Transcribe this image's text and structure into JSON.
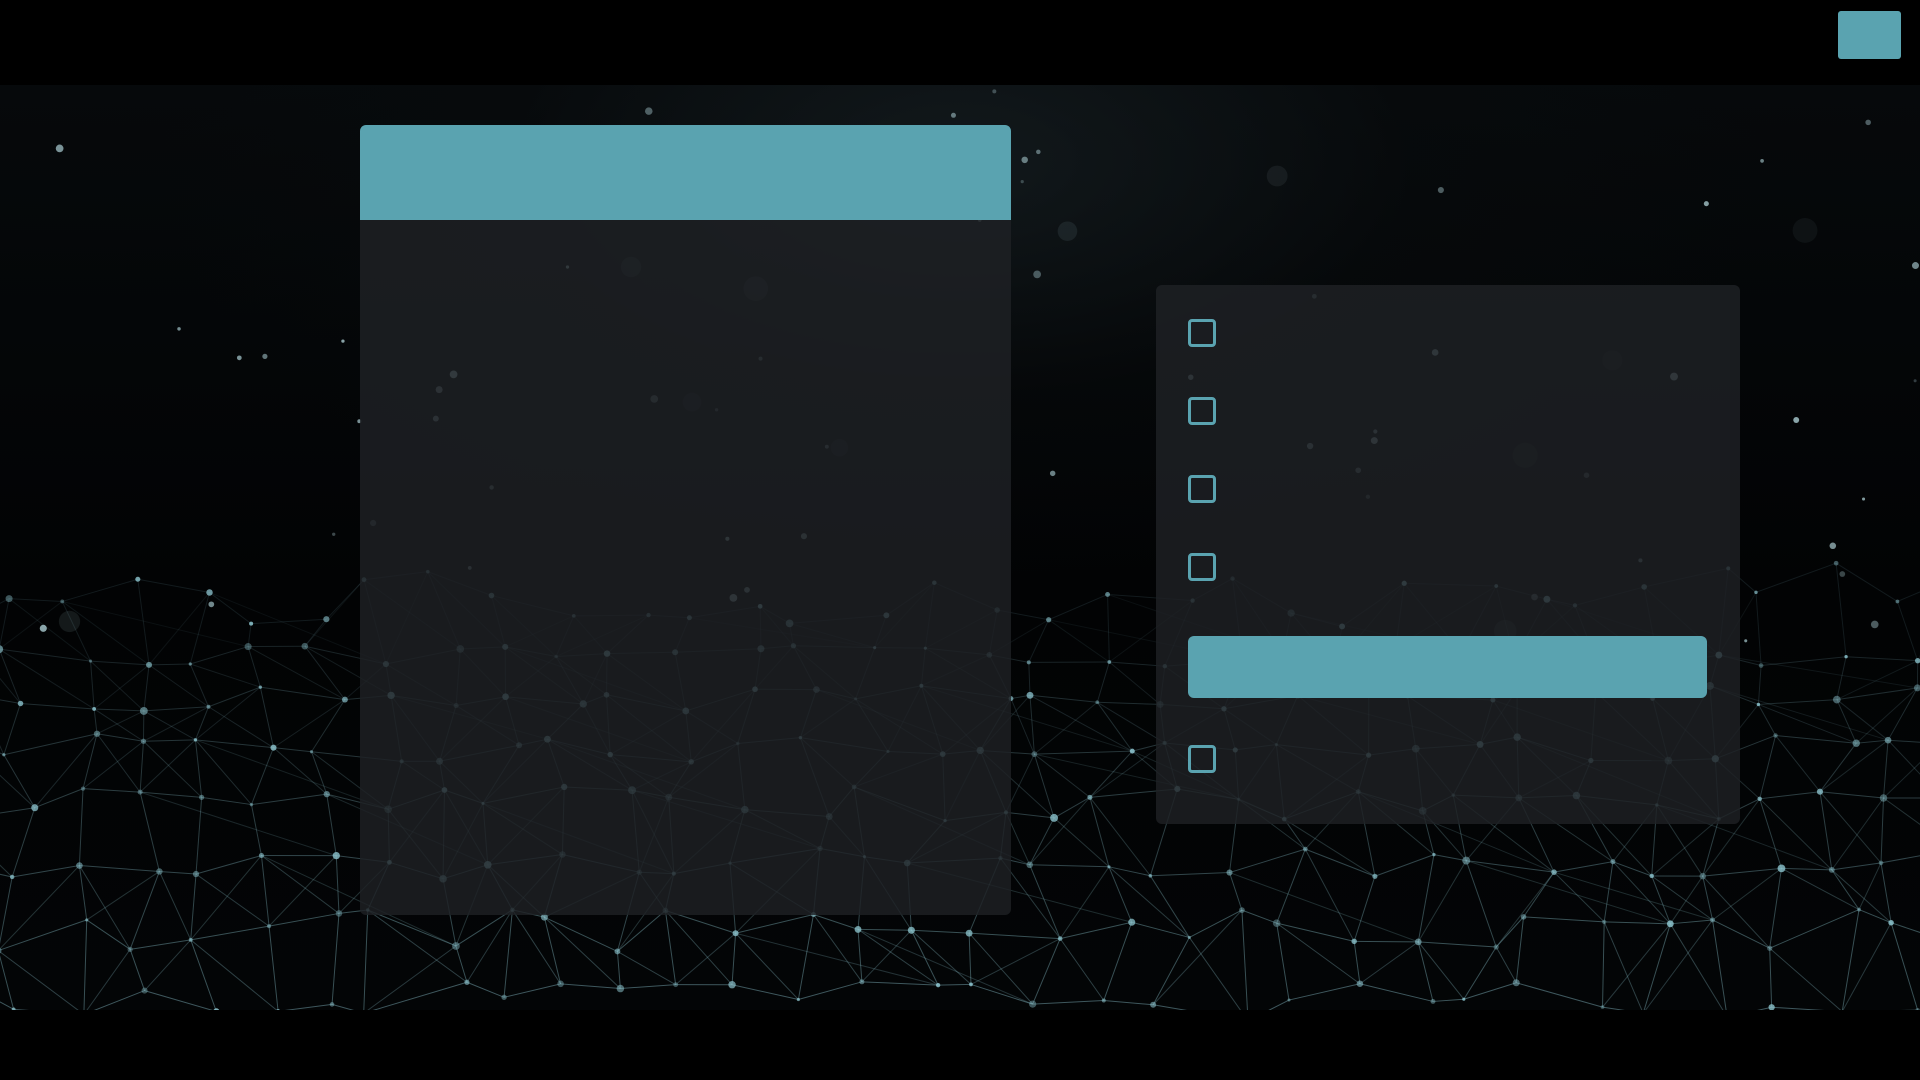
{
  "colors": {
    "accent": "#5aa3b0",
    "panel": "#1e2124",
    "background": "#000000"
  },
  "corner_button": {
    "label": ""
  },
  "left_panel": {
    "header_title": ""
  },
  "right_panel": {
    "options": [
      {
        "label": "",
        "checked": false
      },
      {
        "label": "",
        "checked": false
      },
      {
        "label": "",
        "checked": false
      },
      {
        "label": "",
        "checked": false
      }
    ],
    "primary_button_label": "",
    "footer_option": {
      "label": "",
      "checked": false
    }
  }
}
